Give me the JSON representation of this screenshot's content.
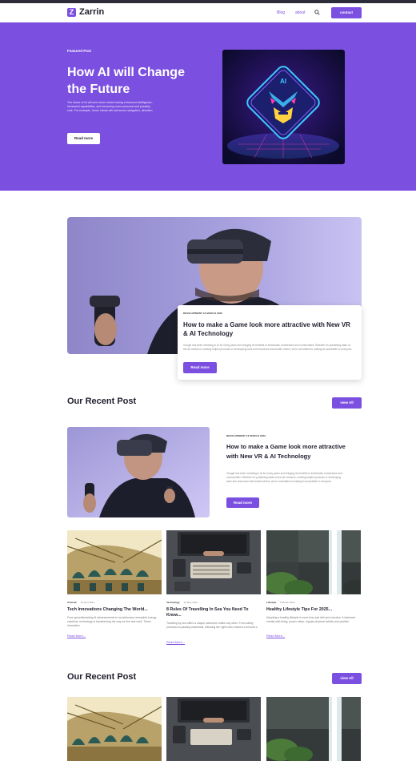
{
  "nav": {
    "brand": "Zarrin",
    "links": [
      "Blog",
      "about"
    ],
    "contact": "contact"
  },
  "hero": {
    "eyebrow": "Featured Post",
    "title": "How AI will Change the Future",
    "description": "The future of AI will see home robots having enhanced intelligence, increased capabilities, and becoming more personal and possibly cute. For example, home robots will overcome navigation, direction",
    "button": "Read more",
    "image_badge": "AI"
  },
  "feature": {
    "meta": "DEVELOPMENT   16 MARCH 2023",
    "title": "How to make a Game look more attractive with New VR & AI Technology",
    "description": "Google has been investing in AI for many years and bringing its benefits to individuals, businesses and communities. Whether it's publishing state-of-the-art research, building helpful products or developing tools and resources that enable others, we're committed to making AI accessible to everyone.",
    "button": "Read more"
  },
  "recent1": {
    "heading": "Our Recent Post",
    "view_all": "view All",
    "post": {
      "meta": "DEVELOPMENT   16 MARCH 2023",
      "title": "How to make a Game look more attractive with New VR & AI Technology",
      "description": "Google has been investing in AI for many years and bringing its benefits to individuals, businesses and communities. Whether it's publishing state-of-the-art research, building helpful products or developing tools and resources that enable others, we're committed to making AI accessible to everyone.",
      "button": "Read more"
    },
    "cards": [
      {
        "category": "Android",
        "date": "15 April 2024",
        "title": "Tech Innovations Changing The World...",
        "description": "From groundbreaking AI advancements to revolutionary renewable energy solutions, technology is transforming the way we live and work. These innovation",
        "link": "Read More..."
      },
      {
        "category": "Technology",
        "date": "22 May 2024",
        "title": "8 Rules Of Travelling In Sea You Need To Know...",
        "description": "Traveling by sea offers a unique adventure unlike any other. From safety protocols to packing essentials, following the right rules ensures a smooth a",
        "link": "Read More..."
      },
      {
        "category": "Lifestyle",
        "date": "8 March 2024",
        "title": "Healthy Lifestyle Tips For 2025...",
        "description": "Adopting a healthy lifestyle is more than just diet and exercise. A balanced mental well-being, proper sleep, regular physical activity and positive",
        "link": "Read More..."
      }
    ]
  },
  "recent2": {
    "heading": "Our Recent Post",
    "view_all": "view All"
  },
  "colors": {
    "accent": "#7b4fe0",
    "dark": "#1f1f2e"
  },
  "icons": [
    "zarrin-logo-icon",
    "search-icon"
  ]
}
